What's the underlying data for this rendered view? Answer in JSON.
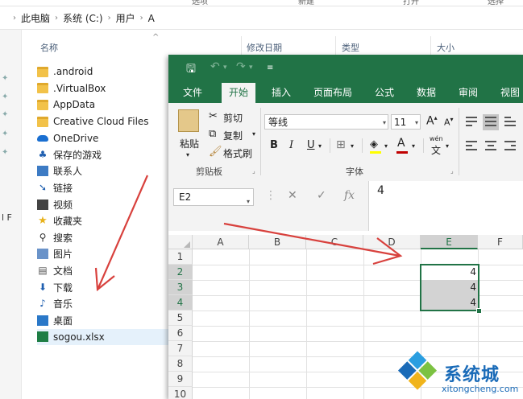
{
  "explorer": {
    "ribbon_top": [
      "选项",
      "新建",
      "打开",
      "选择"
    ],
    "breadcrumb": [
      "此电脑",
      "系统 (C:)",
      "用户",
      "A"
    ],
    "columns": {
      "name": "名称",
      "date": "修改日期",
      "type": "类型",
      "size": "大小"
    },
    "files": [
      {
        "name": ".android",
        "icon": "folder-icon"
      },
      {
        "name": ".VirtualBox",
        "icon": "folder-icon"
      },
      {
        "name": "AppData",
        "icon": "folder-icon"
      },
      {
        "name": "Creative Cloud Files",
        "icon": "folder-icon"
      },
      {
        "name": "OneDrive",
        "icon": "onedrive-icon"
      },
      {
        "name": "保存的游戏",
        "icon": "saved-games-icon"
      },
      {
        "name": "联系人",
        "icon": "contacts-icon"
      },
      {
        "name": "链接",
        "icon": "links-icon"
      },
      {
        "name": "视频",
        "icon": "videos-icon"
      },
      {
        "name": "收藏夹",
        "icon": "favorites-icon"
      },
      {
        "name": "搜索",
        "icon": "search-icon"
      },
      {
        "name": "图片",
        "icon": "pictures-icon"
      },
      {
        "name": "文档",
        "icon": "documents-icon"
      },
      {
        "name": "下载",
        "icon": "downloads-icon"
      },
      {
        "name": "音乐",
        "icon": "music-icon"
      },
      {
        "name": "桌面",
        "icon": "desktop-icon"
      },
      {
        "name": "sogou.xlsx",
        "icon": "excel-file-icon"
      }
    ],
    "selected_file": "sogou.xlsx",
    "navpane_edge_text": "l F"
  },
  "excel": {
    "tabs": [
      "文件",
      "开始",
      "插入",
      "页面布局",
      "公式",
      "数据",
      "审阅",
      "视图"
    ],
    "active_tab": "开始",
    "clipboard": {
      "paste": "粘贴",
      "cut": "剪切",
      "copy": "复制",
      "format_painter": "格式刷",
      "group": "剪贴板"
    },
    "font": {
      "name": "等线",
      "size": "11",
      "grow": "A",
      "shrink": "A",
      "bold": "B",
      "italic": "I",
      "underline": "U",
      "group": "字体",
      "fill_color": "#ffff00",
      "font_color": "#c00000",
      "phonetic": "wén"
    },
    "name_box": "E2",
    "formula_value": "4",
    "columns": [
      "A",
      "B",
      "C",
      "D",
      "E",
      "F"
    ],
    "rows": [
      "1",
      "2",
      "3",
      "4",
      "5",
      "6",
      "7",
      "8",
      "9",
      "10"
    ],
    "selected_column": "E",
    "selected_rows": [
      "2",
      "3",
      "4"
    ],
    "cells": {
      "E2": "4",
      "E3": "4",
      "E4": "4"
    },
    "accent_color": "#217346"
  },
  "watermark": {
    "text": "系统城",
    "url": "xitongcheng.com"
  }
}
